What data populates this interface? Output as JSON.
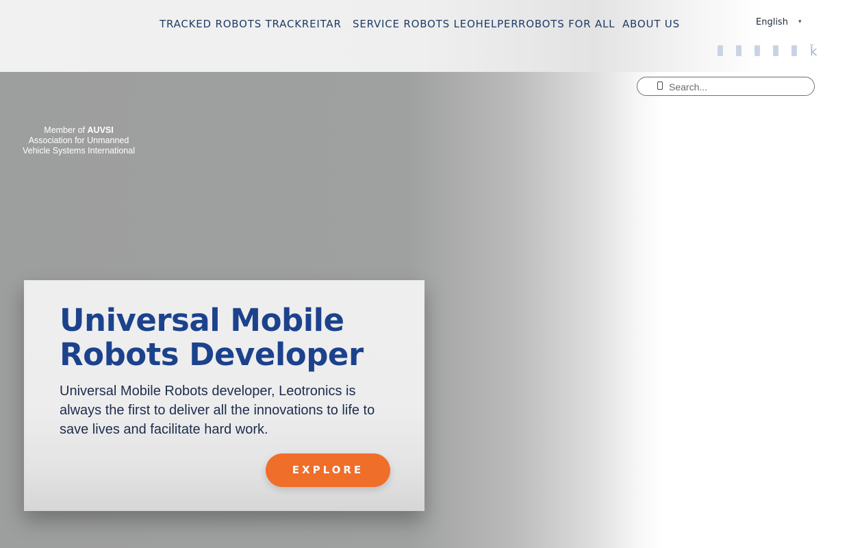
{
  "nav": {
    "items": [
      {
        "label": "TRACKED ROBOTS TRACKREITAR"
      },
      {
        "label": "SERVICE ROBOTS LEOHELPER"
      },
      {
        "label": "ROBOTS FOR ALL"
      },
      {
        "label": "ABOUT US"
      }
    ]
  },
  "language": {
    "selected": "English"
  },
  "social": [
    "social-icon",
    "social-icon",
    "social-icon",
    "social-icon",
    "social-icon",
    "social-icon"
  ],
  "search": {
    "placeholder": "Search..."
  },
  "member": {
    "prefix": "Member of",
    "org": "AUVSI",
    "line2": "Association for Unmanned",
    "line3": "Vehicle Systems International"
  },
  "hero": {
    "title_line1": "Universal Mobile",
    "title_line2": "Robots Developer",
    "description": "Universal Mobile Robots developer, Leotronics is always the first to deliver all the innovations to life to save lives and facilitate hard work.",
    "button_label": "EXPLORE"
  },
  "colors": {
    "nav_text": "#1d3b66",
    "title": "#1c428c",
    "accent": "#ef6e2a"
  }
}
